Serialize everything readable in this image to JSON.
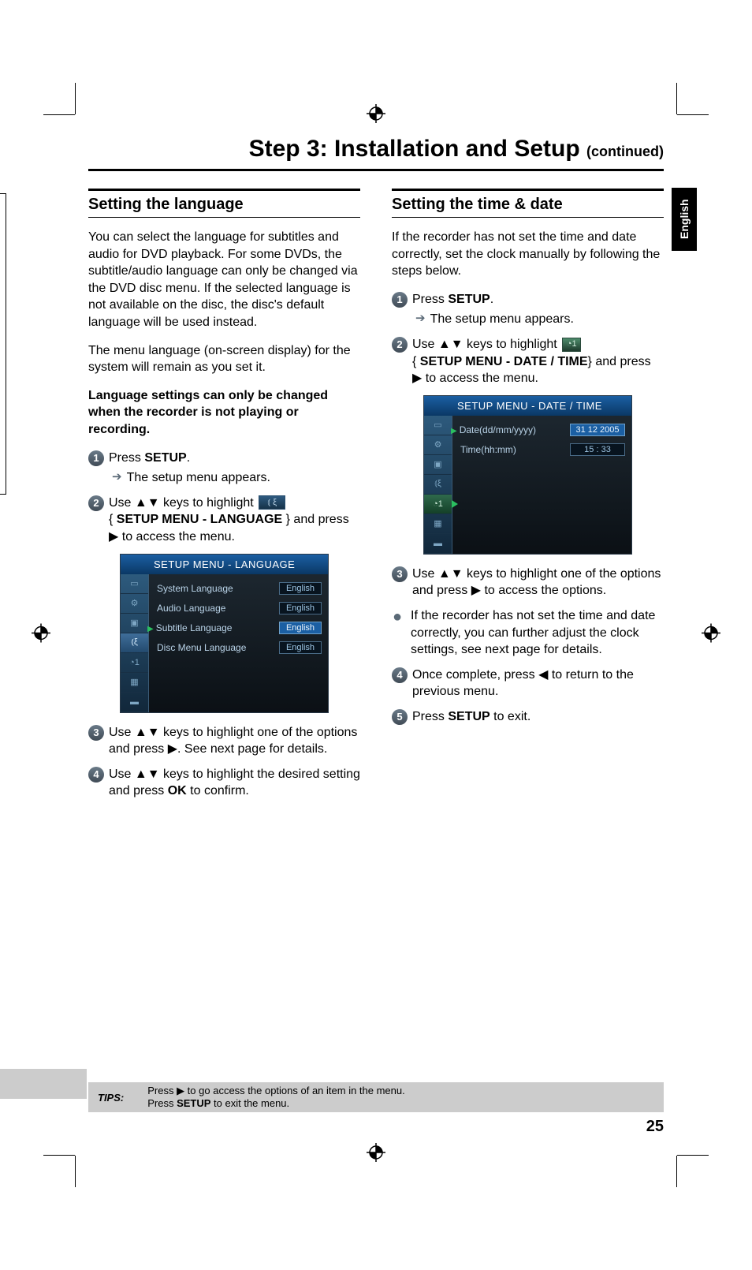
{
  "page_title": "Step 3: Installation and Setup",
  "page_title_cont": "(continued)",
  "lang_tab": "English",
  "page_number": "25",
  "left": {
    "heading": "Setting the language",
    "p1": "You can select the language for subtitles and audio for DVD playback. For some DVDs, the subtitle/audio language can only be changed via the DVD disc menu. If the selected language is not available on the disc, the disc's default language will be used instead.",
    "p2": "The menu language (on-screen display) for the system will remain as you set it.",
    "p3": "Language settings can only be changed when the recorder is not playing or recording.",
    "s1a": "Press ",
    "s1b": "SETUP",
    "s1c": ".",
    "s1_sub": "The setup menu appears.",
    "s2a": "Use ▲▼ keys to highlight ",
    "s2b": "{ ",
    "s2c": "SETUP MENU - LANGUAGE",
    "s2d": " } and press ▶ to access the menu.",
    "panel": {
      "title": "SETUP MENU - LANGUAGE",
      "rows": [
        {
          "label": "System Language",
          "value": "English"
        },
        {
          "label": "Audio Language",
          "value": "English"
        },
        {
          "label": "Subtitle Language",
          "value": "English",
          "hl": true
        },
        {
          "label": "Disc Menu Language",
          "value": "English"
        }
      ]
    },
    "s3": "Use ▲▼ keys to highlight one of the options and press ▶. See next page for details.",
    "s4a": "Use ▲▼ keys to highlight the desired setting and press ",
    "s4b": "OK",
    "s4c": " to confirm."
  },
  "right": {
    "heading": "Setting the time & date",
    "p1": "If the recorder has not set the time and date correctly, set the clock manually by following the steps below.",
    "s1a": "Press ",
    "s1b": "SETUP",
    "s1c": ".",
    "s1_sub": "The setup menu appears.",
    "s2a": "Use ▲▼ keys to highlight ",
    "s2b": "{ ",
    "s2c": "SETUP MENU - DATE / TIME",
    "s2d": "} and press ▶ to access the menu.",
    "panel": {
      "title": "SETUP MENU - DATE / TIME",
      "rows": [
        {
          "label": "Date(dd/mm/yyyy)",
          "value": "31 12 2005",
          "hl": true
        },
        {
          "label": "Time(hh:mm)",
          "value": "15 : 33"
        }
      ]
    },
    "s3": "Use ▲▼ keys to highlight one of the options and press ▶ to access the options.",
    "bullet": "If the recorder has not set the time and date correctly, you can further adjust the clock settings, see next page for details.",
    "s4": "Once complete, press ◀ to return to the previous menu.",
    "s5a": "Press ",
    "s5b": "SETUP",
    "s5c": " to exit."
  },
  "tips": {
    "label": "TIPS:",
    "l1a": "Press ▶ to go access the options of an item in the menu.",
    "l2a": "Press ",
    "l2b": "SETUP",
    "l2c": " to exit the menu."
  }
}
